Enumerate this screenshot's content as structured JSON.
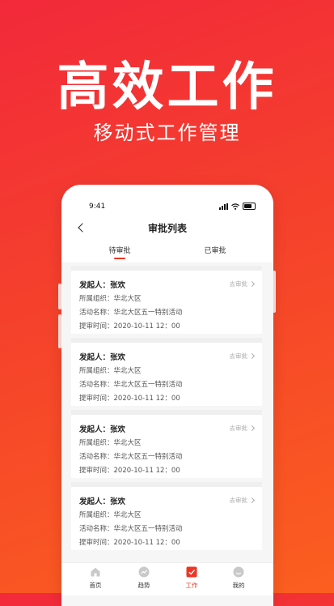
{
  "hero": {
    "title": "高效工作",
    "subtitle": "移动式工作管理"
  },
  "status_bar": {
    "time": "9:41"
  },
  "nav": {
    "title": "审批列表"
  },
  "tabs": [
    {
      "label": "待审批",
      "active": true
    },
    {
      "label": "已审批",
      "active": false
    }
  ],
  "cards": [
    {
      "initiator": "发起人：张欢",
      "org": "所属组织：华北大区",
      "activity": "活动名称：华北大区五一特别活动",
      "time": "提审时间：2020-10-11 12：00",
      "action": "去审批"
    },
    {
      "initiator": "发起人：张欢",
      "org": "所属组织：华北大区",
      "activity": "活动名称：华北大区五一特别活动",
      "time": "提审时间：2020-10-11 12：00",
      "action": "去审批"
    },
    {
      "initiator": "发起人：张欢",
      "org": "所属组织：华北大区",
      "activity": "活动名称：华北大区五一特别活动",
      "time": "提审时间：2020-10-11 12：00",
      "action": "去审批"
    },
    {
      "initiator": "发起人：张欢",
      "org": "所属组织：华北大区",
      "activity": "活动名称：华北大区五一特别活动",
      "time": "提审时间：2020-10-11 12：00",
      "action": "去审批"
    }
  ],
  "tabbar": [
    {
      "label": "首页",
      "icon": "home-icon",
      "active": false
    },
    {
      "label": "趋势",
      "icon": "trend-icon",
      "active": false
    },
    {
      "label": "工作",
      "icon": "work-check-icon",
      "active": true
    },
    {
      "label": "我的",
      "icon": "profile-icon",
      "active": false
    }
  ],
  "colors": {
    "accent": "#ee3524",
    "inactive_icon": "#c9c9c9",
    "bg_gradient_start": "#f2293a",
    "bg_gradient_end": "#fb5f1f"
  }
}
